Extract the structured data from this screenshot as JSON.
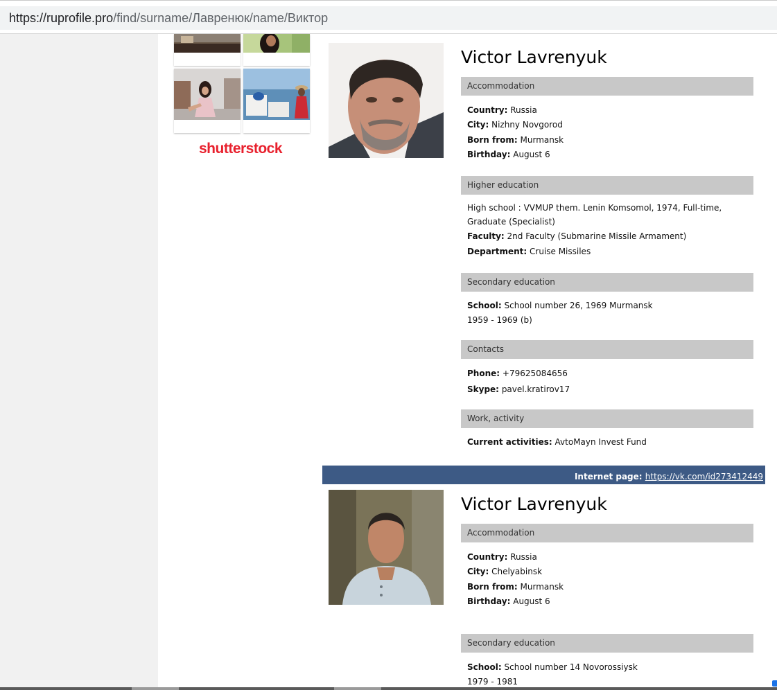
{
  "browser": {
    "url_host": "https://ruprofile.pro",
    "url_path": "/find/surname/Лавренюк/name/Виктор"
  },
  "ads": {
    "brand": "shutterstock"
  },
  "profiles": [
    {
      "name": "Victor Lavrenyuk",
      "sections": {
        "accommodation": {
          "title": "Accommodation",
          "country_label": "Country:",
          "country": "Russia",
          "city_label": "City:",
          "city": "Nizhny Novgorod",
          "born_label": "Born from:",
          "born": "Murmansk",
          "birthday_label": "Birthday:",
          "birthday": "August 6"
        },
        "higher_education": {
          "title": "Higher education",
          "school_label": "High school :",
          "school": "VVMUP them. Lenin Komsomol, 1974, Full-time, Graduate (Specialist)",
          "faculty_label": "Faculty:",
          "faculty": "2nd Faculty (Submarine Missile Armament)",
          "department_label": "Department:",
          "department": "Cruise Missiles"
        },
        "secondary_education": {
          "title": "Secondary education",
          "school_label": "School:",
          "school": "School number 26, 1969 Murmansk",
          "years": "1959 - 1969 (b)"
        },
        "contacts": {
          "title": "Contacts",
          "phone_label": "Phone:",
          "phone": "+79625084656",
          "skype_label": "Skype:",
          "skype": "pavel.kratirov17"
        },
        "work": {
          "title": "Work, activity",
          "activities_label": "Current activities:",
          "activities": "AvtoMayn Invest Fund"
        }
      }
    },
    {
      "internet_page_label": "Internet page:",
      "internet_page_url": "https://vk.com/id273412449",
      "name": "Victor Lavrenyuk",
      "sections": {
        "accommodation": {
          "title": "Accommodation",
          "country_label": "Country:",
          "country": "Russia",
          "city_label": "City:",
          "city": "Chelyabinsk",
          "born_label": "Born from:",
          "born": "Murmansk",
          "birthday_label": "Birthday:",
          "birthday": "August 6"
        },
        "secondary_education": {
          "title": "Secondary education",
          "school_label": "School:",
          "school": "School number 14 Novorossiysk",
          "years": "1979 - 1981"
        }
      }
    }
  ]
}
